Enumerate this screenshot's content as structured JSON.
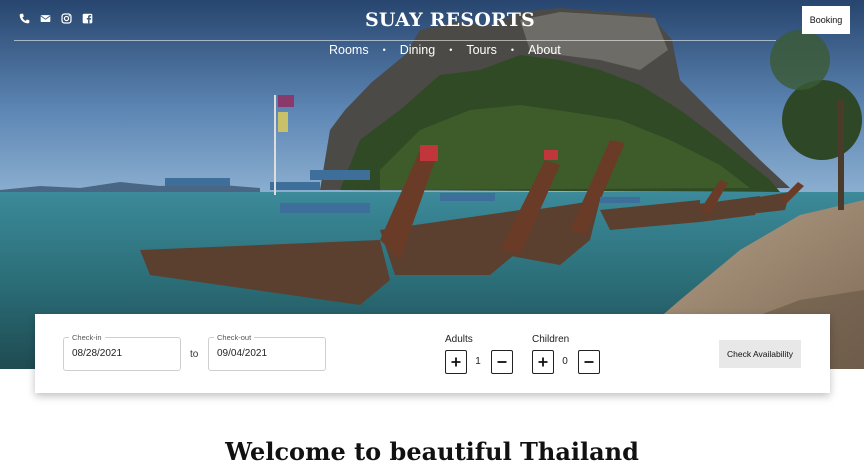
{
  "header": {
    "brand": "SUAY RESORTS",
    "booking_label": "Booking",
    "social_icons": [
      "phone-icon",
      "email-icon",
      "instagram-icon",
      "facebook-icon"
    ]
  },
  "nav": {
    "items": [
      {
        "label": "Rooms"
      },
      {
        "label": "Dining"
      },
      {
        "label": "Tours"
      },
      {
        "label": "About"
      }
    ],
    "separator": "•"
  },
  "booking": {
    "checkin_label": "Check-in",
    "checkin_value": "08/28/2021",
    "to_label": "to",
    "checkout_label": "Check-out",
    "checkout_value": "09/04/2021",
    "adults_label": "Adults",
    "adults_value": "1",
    "children_label": "Children",
    "children_value": "0",
    "check_availability_label": "Check Availability"
  },
  "main": {
    "welcome_title": "Welcome to beautiful Thailand"
  },
  "colors": {
    "accent_white": "#ffffff",
    "text_dark": "#111111",
    "button_gray": "#e8e8e8"
  }
}
